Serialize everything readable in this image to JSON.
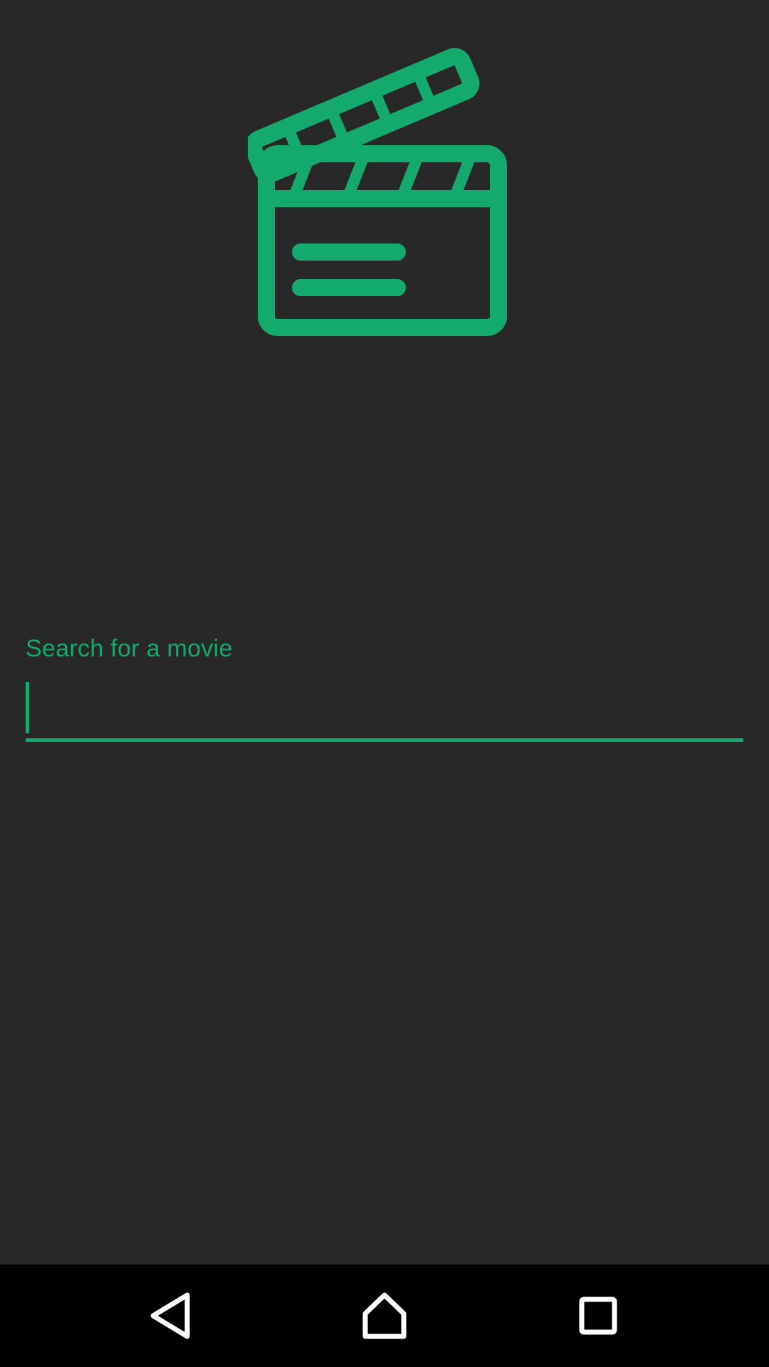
{
  "colors": {
    "accent": "#14A96D",
    "background": "#282828",
    "navbar": "#000000",
    "nav_icon": "#FFFFFF"
  },
  "logo": {
    "icon": "clapperboard-icon"
  },
  "search": {
    "label": "Search for a movie",
    "value": "",
    "placeholder": ""
  },
  "navbar": {
    "back_icon": "back-triangle-icon",
    "home_icon": "home-icon",
    "recent_icon": "recent-apps-square-icon"
  }
}
